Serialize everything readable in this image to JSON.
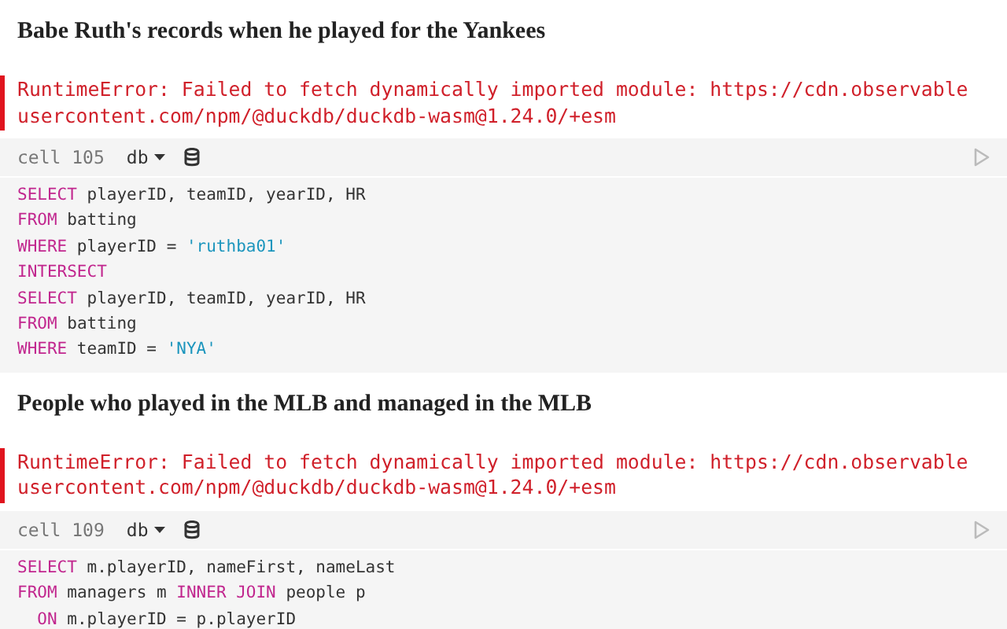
{
  "cells": [
    {
      "heading": "Babe Ruth's records when he played for the Yankees",
      "error": "RuntimeError: Failed to fetch dynamically imported module: https://cdn.observableusercontent.com/npm/@duckdb/duckdb-wasm@1.24.0/+esm",
      "cell_label": "cell 105",
      "source": "db",
      "code_lines": [
        [
          {
            "kind": "keyword",
            "text": "SELECT"
          },
          {
            "kind": "plain",
            "text": " playerID, teamID, yearID, HR"
          }
        ],
        [
          {
            "kind": "keyword",
            "text": "FROM"
          },
          {
            "kind": "plain",
            "text": " batting"
          }
        ],
        [
          {
            "kind": "keyword",
            "text": "WHERE"
          },
          {
            "kind": "plain",
            "text": " playerID = "
          },
          {
            "kind": "string",
            "text": "'ruthba01'"
          }
        ],
        [
          {
            "kind": "keyword",
            "text": "INTERSECT"
          }
        ],
        [
          {
            "kind": "keyword",
            "text": "SELECT"
          },
          {
            "kind": "plain",
            "text": " playerID, teamID, yearID, HR"
          }
        ],
        [
          {
            "kind": "keyword",
            "text": "FROM"
          },
          {
            "kind": "plain",
            "text": " batting"
          }
        ],
        [
          {
            "kind": "keyword",
            "text": "WHERE"
          },
          {
            "kind": "plain",
            "text": " teamID = "
          },
          {
            "kind": "string",
            "text": "'NYA'"
          }
        ]
      ]
    },
    {
      "heading": "People who played in the MLB and managed in the MLB",
      "error": "RuntimeError: Failed to fetch dynamically imported module: https://cdn.observableusercontent.com/npm/@duckdb/duckdb-wasm@1.24.0/+esm",
      "cell_label": "cell 109",
      "source": "db",
      "code_lines": [
        [
          {
            "kind": "keyword",
            "text": "SELECT"
          },
          {
            "kind": "plain",
            "text": " m.playerID, nameFirst, nameLast"
          }
        ],
        [
          {
            "kind": "keyword",
            "text": "FROM"
          },
          {
            "kind": "plain",
            "text": " managers m "
          },
          {
            "kind": "keyword",
            "text": "INNER JOIN"
          },
          {
            "kind": "plain",
            "text": " people p"
          }
        ],
        [
          {
            "kind": "keyword",
            "text": "  ON"
          },
          {
            "kind": "plain",
            "text": " m.playerID = p.playerID"
          }
        ]
      ]
    }
  ]
}
